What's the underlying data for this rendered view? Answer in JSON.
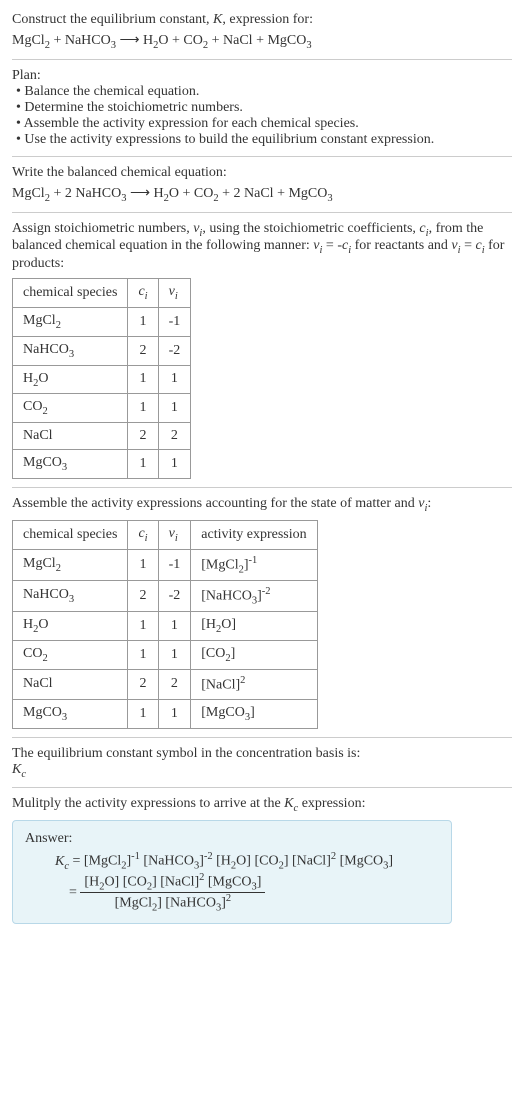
{
  "header": {
    "title": "Construct the equilibrium constant, K, expression for:",
    "equation": "MgCl₂ + NaHCO₃ ⟶ H₂O + CO₂ + NaCl + MgCO₃"
  },
  "plan": {
    "title": "Plan:",
    "items": [
      "• Balance the chemical equation.",
      "• Determine the stoichiometric numbers.",
      "• Assemble the activity expression for each chemical species.",
      "• Use the activity expressions to build the equilibrium constant expression."
    ]
  },
  "balanced": {
    "title": "Write the balanced chemical equation:",
    "equation": "MgCl₂ + 2 NaHCO₃ ⟶ H₂O + CO₂ + 2 NaCl + MgCO₃"
  },
  "stoich": {
    "intro": "Assign stoichiometric numbers, νᵢ, using the stoichiometric coefficients, cᵢ, from the balanced chemical equation in the following manner: νᵢ = -cᵢ for reactants and νᵢ = cᵢ for products:",
    "table": {
      "headers": [
        "chemical species",
        "cᵢ",
        "νᵢ"
      ],
      "rows": [
        {
          "species": "MgCl₂",
          "c": "1",
          "v": "-1"
        },
        {
          "species": "NaHCO₃",
          "c": "2",
          "v": "-2"
        },
        {
          "species": "H₂O",
          "c": "1",
          "v": "1"
        },
        {
          "species": "CO₂",
          "c": "1",
          "v": "1"
        },
        {
          "species": "NaCl",
          "c": "2",
          "v": "2"
        },
        {
          "species": "MgCO₃",
          "c": "1",
          "v": "1"
        }
      ]
    }
  },
  "activity": {
    "intro": "Assemble the activity expressions accounting for the state of matter and νᵢ:",
    "table": {
      "headers": [
        "chemical species",
        "cᵢ",
        "νᵢ",
        "activity expression"
      ],
      "rows": [
        {
          "species": "MgCl₂",
          "c": "1",
          "v": "-1",
          "expr": "[MgCl₂]⁻¹"
        },
        {
          "species": "NaHCO₃",
          "c": "2",
          "v": "-2",
          "expr": "[NaHCO₃]⁻²"
        },
        {
          "species": "H₂O",
          "c": "1",
          "v": "1",
          "expr": "[H₂O]"
        },
        {
          "species": "CO₂",
          "c": "1",
          "v": "1",
          "expr": "[CO₂]"
        },
        {
          "species": "NaCl",
          "c": "2",
          "v": "2",
          "expr": "[NaCl]²"
        },
        {
          "species": "MgCO₃",
          "c": "1",
          "v": "1",
          "expr": "[MgCO₃]"
        }
      ]
    }
  },
  "symbol": {
    "text": "The equilibrium constant symbol in the concentration basis is:",
    "value": "K_c"
  },
  "multiply": {
    "text": "Mulitply the activity expressions to arrive at the K_c expression:"
  },
  "answer": {
    "label": "Answer:",
    "line1": "K_c = [MgCl₂]⁻¹ [NaHCO₃]⁻² [H₂O] [CO₂] [NaCl]² [MgCO₃]",
    "frac_num": "[H₂O] [CO₂] [NaCl]² [MgCO₃]",
    "frac_den": "[MgCl₂] [NaHCO₃]²"
  }
}
